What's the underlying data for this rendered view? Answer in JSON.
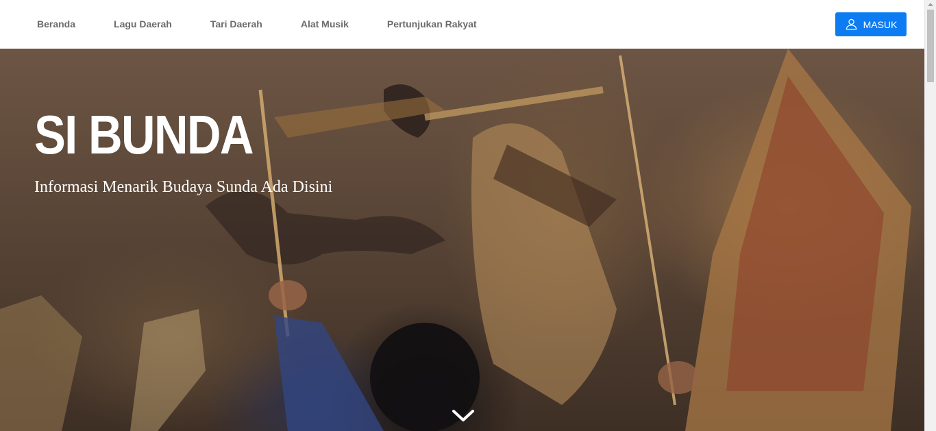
{
  "navbar": {
    "links": [
      {
        "label": "Beranda"
      },
      {
        "label": "Lagu Daerah"
      },
      {
        "label": "Tari Daerah"
      },
      {
        "label": "Alat Musik"
      },
      {
        "label": "Pertunjukan Rakyat"
      }
    ],
    "login_label": "MASUK",
    "login_icon": "user-icon",
    "accent_color": "#0d7cf2"
  },
  "hero": {
    "title": "SI BUNDA",
    "subtitle": "Informasi Menarik Budaya Sunda Ada Disini",
    "scroll_icon": "chevron-down-icon",
    "image_subject": "wayang-puppets-photo"
  }
}
